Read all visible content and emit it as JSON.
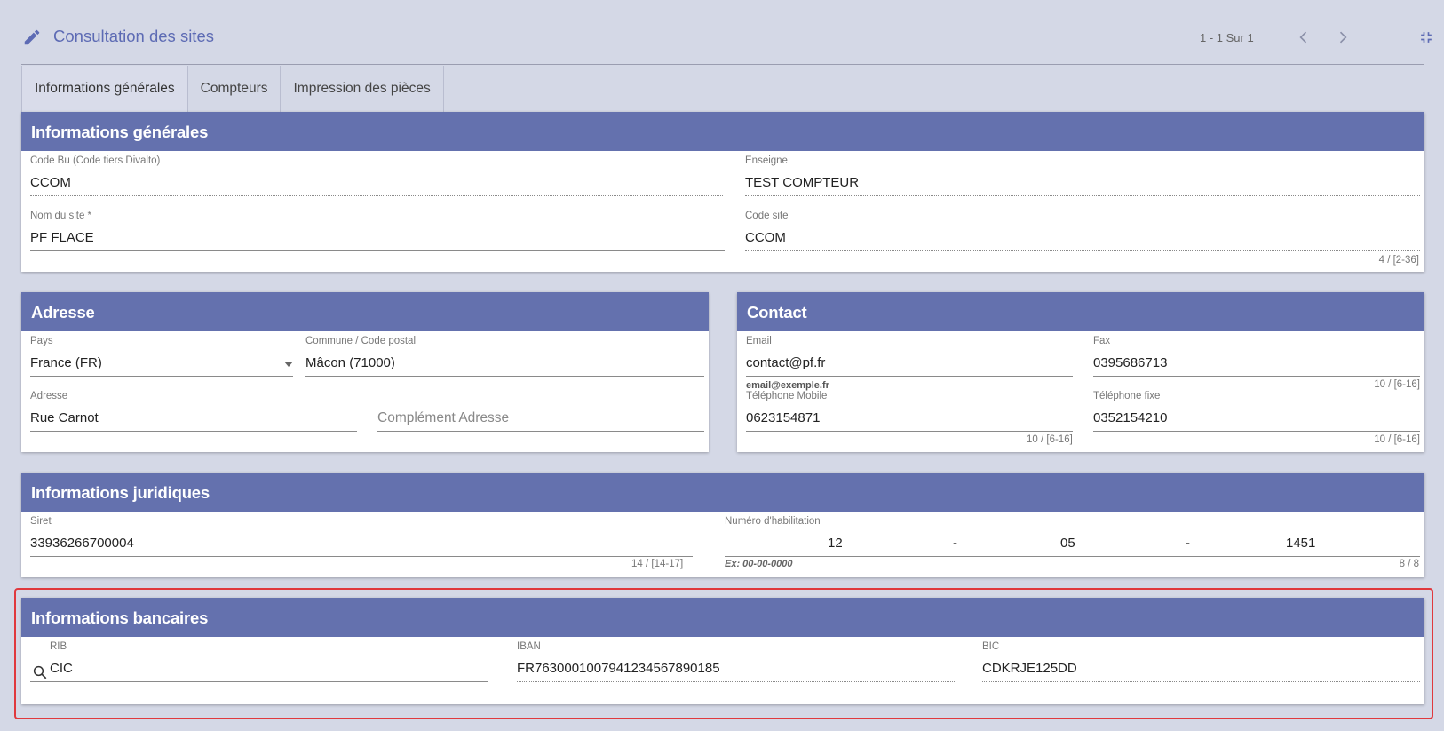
{
  "header": {
    "title": "Consultation des sites",
    "pager": "1 - 1 Sur 1",
    "icons": {
      "edit": "pencil-icon",
      "prev": "chevron-left-icon",
      "next": "chevron-right-icon",
      "collapse": "fullscreen-exit-icon"
    }
  },
  "tabs": [
    {
      "label": "Informations générales",
      "active": true
    },
    {
      "label": "Compteurs",
      "active": false
    },
    {
      "label": "Impression des pièces",
      "active": false
    }
  ],
  "general": {
    "title": "Informations générales",
    "code_bu_label": "Code Bu (Code tiers Divalto)",
    "code_bu_value": "CCOM",
    "enseigne_label": "Enseigne",
    "enseigne_value": "TEST COMPTEUR",
    "nom_site_label": "Nom du site *",
    "nom_site_value": "PF FLACE",
    "code_site_label": "Code site",
    "code_site_value": "CCOM",
    "code_site_counter": "4 / [2-36]"
  },
  "adresse": {
    "title": "Adresse",
    "pays_label": "Pays",
    "pays_value": "France (FR)",
    "commune_label": "Commune / Code postal",
    "commune_value": "Mâcon (71000)",
    "adresse_label": "Adresse",
    "adresse_value": "Rue Carnot",
    "complement_placeholder": "Complément Adresse"
  },
  "contact": {
    "title": "Contact",
    "email_label": "Email",
    "email_value": "contact@pf.fr",
    "email_hint": "email@exemple.fr",
    "fax_label": "Fax",
    "fax_value": "0395686713",
    "fax_counter": "10 / [6-16]",
    "mobile_label": "Téléphone Mobile",
    "mobile_value": "0623154871",
    "mobile_counter": "10 / [6-16]",
    "fixe_label": "Téléphone fixe",
    "fixe_value": "0352154210",
    "fixe_counter": "10 / [6-16]"
  },
  "juridique": {
    "title": "Informations juridiques",
    "siret_label": "Siret",
    "siret_value": "33936266700004",
    "siret_counter": "14 / [14-17]",
    "habilitation_label": "Numéro d'habilitation",
    "hab_part1": "12",
    "hab_sep1": "-",
    "hab_part2": "05",
    "hab_sep2": "-",
    "hab_part3": "1451",
    "hab_hint": "Ex: 00-00-0000",
    "hab_counter": "8 / 8"
  },
  "bancaire": {
    "title": "Informations bancaires",
    "rib_label": "RIB",
    "rib_value": "CIC",
    "iban_label": "IBAN",
    "iban_value": "FR7630001007941234567890185",
    "bic_label": "BIC",
    "bic_value": "CDKRJE125DD",
    "search_icon": "search-icon"
  },
  "colors": {
    "accent": "#6471ae",
    "title": "#5d6bb4",
    "background": "#d4d8e6",
    "highlight": "#e0393e"
  }
}
